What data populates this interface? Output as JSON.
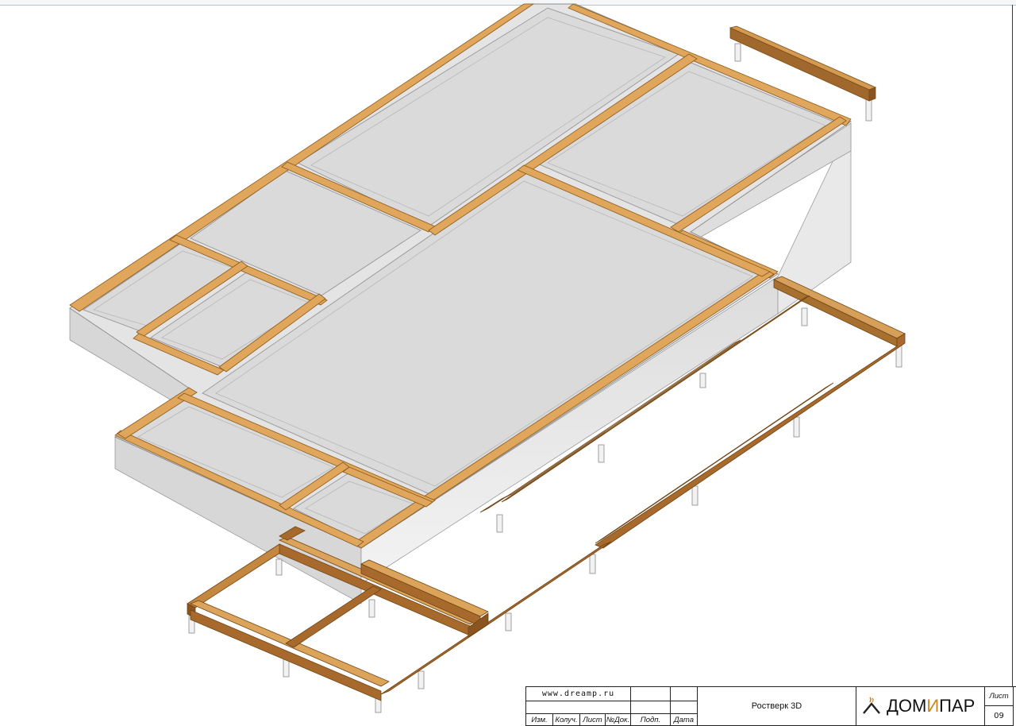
{
  "drawing": {
    "elements": [
      "concrete-slab",
      "formwork-boards",
      "wooden-grillage-beams",
      "support-piles"
    ]
  },
  "title_block": {
    "website": "www.dreamp.ru",
    "headers": [
      "Изм.",
      "Колуч.",
      "Лист",
      "№Док.",
      "Подп.",
      "Дата"
    ],
    "drawing_title": "Ростверк 3D",
    "logo_text_left": "ДОМ",
    "logo_text_mid": "И",
    "logo_text_right": "ПАР",
    "sheet_label": "Лист",
    "sheet_number": "09"
  },
  "colors": {
    "concrete": "#e6e6e6",
    "board": "#d9a25a",
    "beam_dark": "#a86a2c",
    "beam_light": "#f3ddb3",
    "accent": "#c8872b"
  }
}
